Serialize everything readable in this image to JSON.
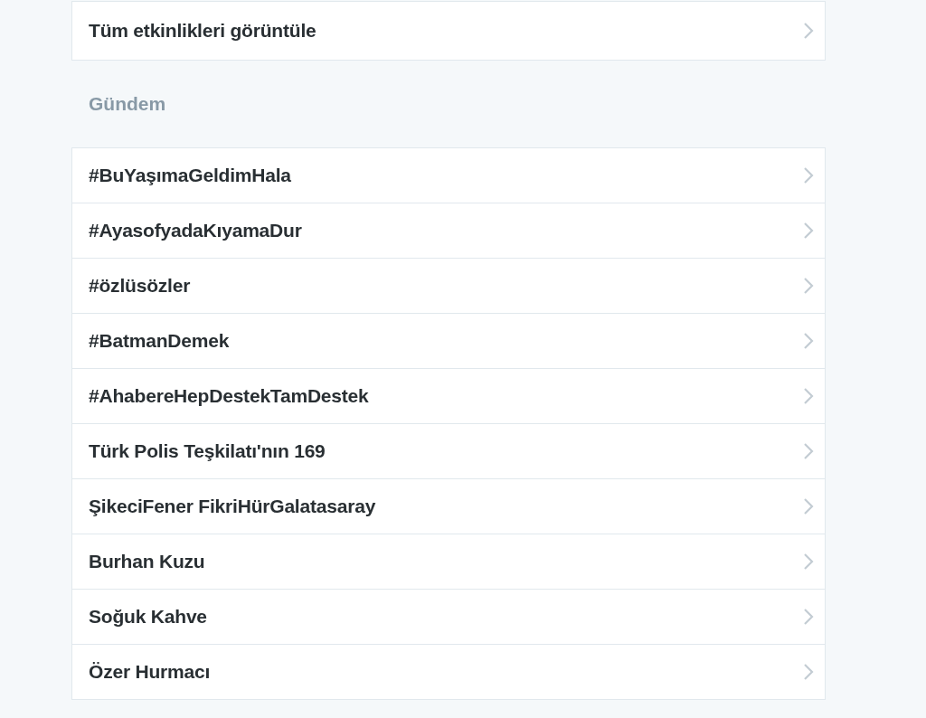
{
  "top_list": {
    "items": [
      {
        "label": "Tüm etkinlikleri görüntüle"
      }
    ]
  },
  "trends": {
    "title": "Gündem",
    "items": [
      {
        "label": "#BuYaşımaGeldimHala"
      },
      {
        "label": "#AyasofyadaKıyamaDur"
      },
      {
        "label": "#özlüsözler"
      },
      {
        "label": "#BatmanDemek"
      },
      {
        "label": "#AhabereHepDestekTamDestek"
      },
      {
        "label": "Türk Polis Teşkilatı'nın 169"
      },
      {
        "label": "ŞikeciFener FikriHürGalatasaray"
      },
      {
        "label": "Burhan Kuzu"
      },
      {
        "label": "Soğuk Kahve"
      },
      {
        "label": "Özer Hurmacı"
      }
    ]
  }
}
